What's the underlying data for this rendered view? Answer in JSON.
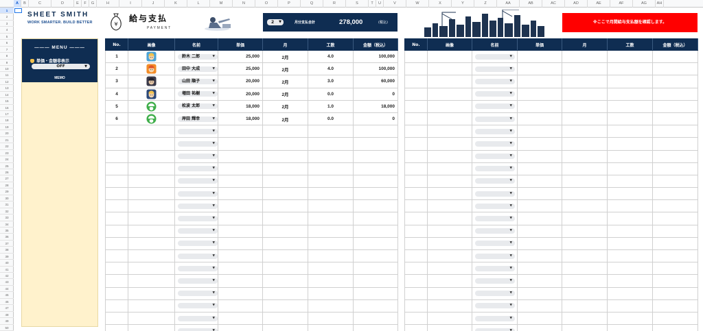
{
  "sheet": {
    "columns": [
      "A",
      "B",
      "C",
      "D",
      "E",
      "F",
      "G",
      "H",
      "I",
      "J",
      "K",
      "L",
      "M",
      "N",
      "O",
      "P",
      "Q",
      "R",
      "S",
      "T",
      "U",
      "V",
      "W",
      "X",
      "Y",
      "Z",
      "AA",
      "AB",
      "AC",
      "AD",
      "AE",
      "AF",
      "AG",
      "AH"
    ],
    "selected_column": "A",
    "rows_visible": 50,
    "selected_row": 1
  },
  "brand": {
    "name": "SHEET SMITH",
    "tagline": "WORK SMARTER. BUILD BETTER"
  },
  "sidebar": {
    "menu_title": "——— MENU ———",
    "toggle_label": "単価・金額非表示",
    "toggle_value": "OFF",
    "memo_label": "MEMO"
  },
  "header": {
    "title": "給与支払",
    "subtitle": "PAYMENT",
    "month_select": "2",
    "total_label": "月分支払合計",
    "total_value": "278,000",
    "tax_note": "(税込)",
    "alert_text": "※ここで月間給与支払額を確認します。"
  },
  "table_headers": [
    "No.",
    "画像",
    "名前",
    "単価",
    "月",
    "工数",
    "金額（税込）"
  ],
  "rows": [
    {
      "no": "1",
      "avatar": "worker-blonde",
      "name": "鈴木 二郎",
      "unit_price": "25,000",
      "month": "2月",
      "hours": "4.0",
      "amount": "100,000"
    },
    {
      "no": "2",
      "avatar": "worker-orange",
      "name": "田中 大成",
      "unit_price": "25,000",
      "month": "2月",
      "hours": "4.0",
      "amount": "100,000"
    },
    {
      "no": "3",
      "avatar": "worker-dark",
      "name": "山田 順子",
      "unit_price": "20,000",
      "month": "2月",
      "hours": "3.0",
      "amount": "60,000"
    },
    {
      "no": "4",
      "avatar": "worker-helmet",
      "name": "増田 祐樹",
      "unit_price": "20,000",
      "month": "2月",
      "hours": "0.0",
      "amount": "0"
    },
    {
      "no": "5",
      "avatar": "green-helmet",
      "name": "松波 太郎",
      "unit_price": "18,000",
      "month": "2月",
      "hours": "1.0",
      "amount": "18,000"
    },
    {
      "no": "6",
      "avatar": "green-helmet",
      "name": "岸田 輝幸",
      "unit_price": "18,000",
      "month": "2月",
      "hours": "0.0",
      "amount": "0"
    }
  ],
  "total_rows": 23,
  "colors": {
    "navy": "#0f2d52",
    "memo_bg": "#fff2cc",
    "alert_red": "#ff0000",
    "select_blue": "#1a73e8"
  }
}
